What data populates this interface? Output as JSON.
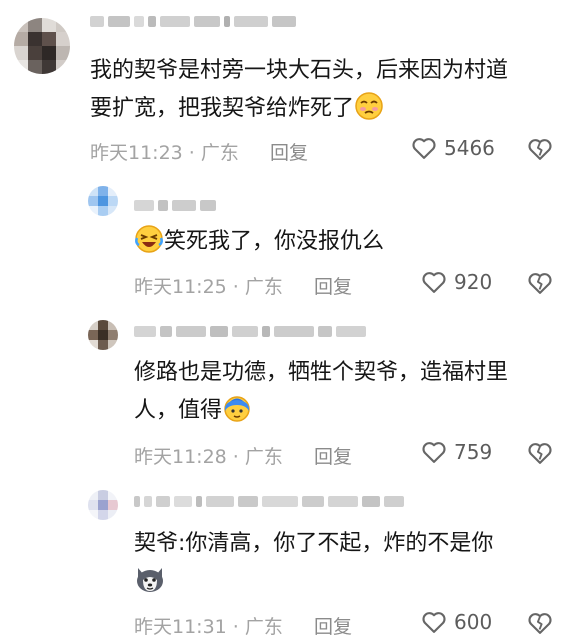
{
  "comments": [
    {
      "text_lines": [
        "我的契爷是村旁一块大石头，后来因为村道",
        "要扩宽，把我契爷给炸死了"
      ],
      "emoji": "cry-face-emoji",
      "time": "昨天11:23 · 广东",
      "reply": "回复",
      "likes": "5466"
    },
    {
      "text_lines": [
        "笑死我了，你没报仇么"
      ],
      "emoji": "laugh-cry-emoji",
      "time": "昨天11:25 · 广东",
      "reply": "回复",
      "likes": "920"
    },
    {
      "text_lines": [
        "修路也是功德，牺牲个契爷，造福村里",
        "人，值得"
      ],
      "emoji": "blue-face-emoji",
      "time": "昨天11:28 · 广东",
      "reply": "回复",
      "likes": "759"
    },
    {
      "text_lines": [
        "契爷:你清高，你了不起，炸的不是你"
      ],
      "emoji": "husky-dog-emoji",
      "time": "昨天11:31 · 广东",
      "reply": "回复",
      "likes": "600"
    }
  ],
  "icons": {
    "like": "heart-outline-icon",
    "dislike": "broken-heart-icon"
  }
}
